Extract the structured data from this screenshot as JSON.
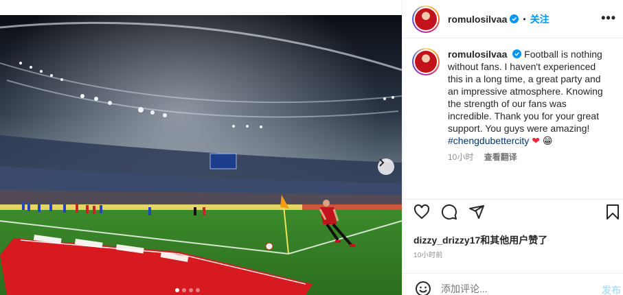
{
  "post": {
    "username": "romulosilvaa",
    "follow_label": "关注",
    "separator": "•",
    "more_label": "•••"
  },
  "caption": {
    "username": "romulosilvaa",
    "text": "Football is nothing without fans. I haven't experienced this in a long time, a great party and an impressive atmosphere. Knowing the strength of our fans was incredible. Thank you for your great support. You guys were amazing!",
    "hashtag": "#chengdubettercity",
    "heart": "❤",
    "emoji": "😁",
    "time": "10小时",
    "translate_label": "查看翻译"
  },
  "likes": {
    "text": "dizzy_drizzy17和其他用户赞了"
  },
  "timestamp": "10小时前",
  "comment": {
    "placeholder": "添加评论...",
    "post_label": "发布"
  },
  "carousel": {
    "dots": 4,
    "active_index": 0
  },
  "colors": {
    "accent": "#0095f6",
    "hashtag": "#00376b",
    "muted": "#8e8e8e",
    "jersey": "#c2121b"
  },
  "icons": [
    "verified-icon",
    "more-icon",
    "chevron-right-icon",
    "heart-icon",
    "comment-icon",
    "share-icon",
    "bookmark-icon",
    "smile-icon"
  ]
}
